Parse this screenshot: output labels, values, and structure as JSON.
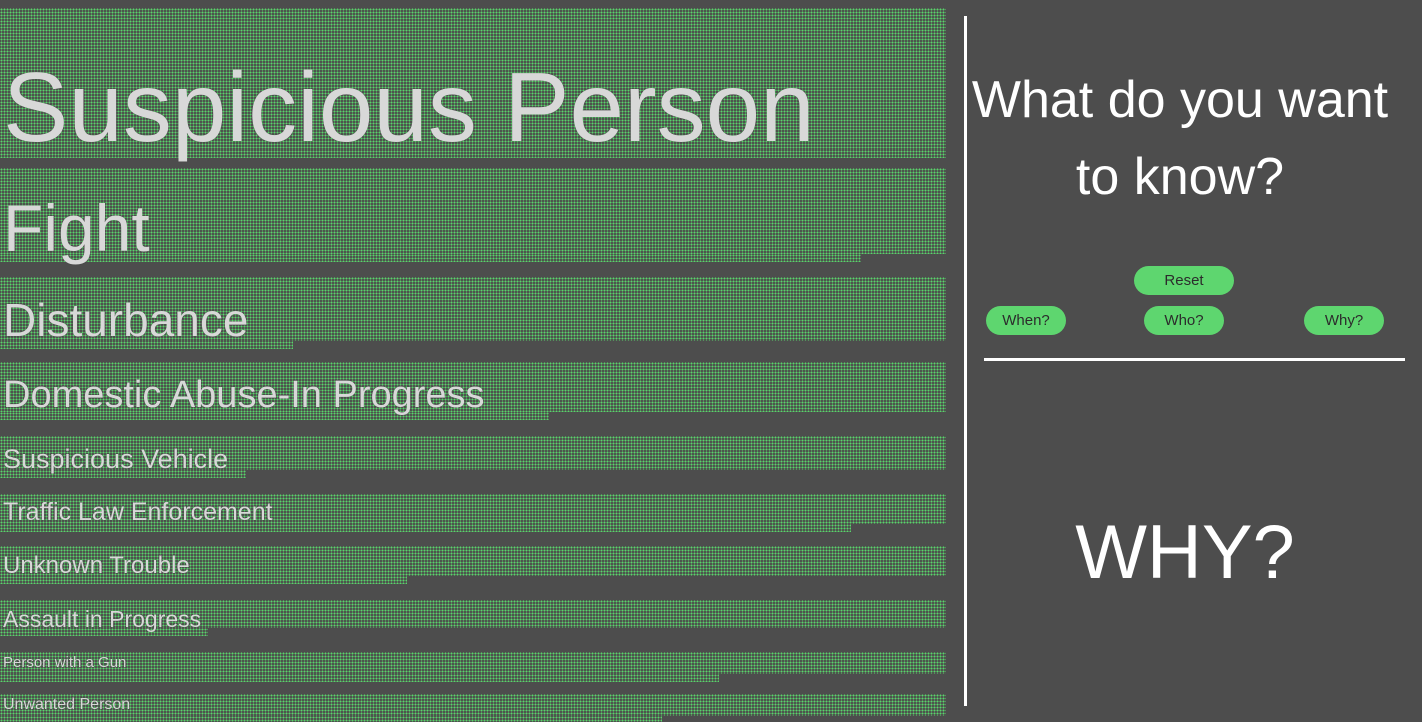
{
  "categories": [
    {
      "label": "Suspicious Person",
      "level": 1.0
    },
    {
      "label": "Fight",
      "level": 0.91
    },
    {
      "label": "Disturbance",
      "level": 0.31
    },
    {
      "label": "Domestic Abuse-In Progress",
      "level": 0.58
    },
    {
      "label": "Suspicious Vehicle",
      "level": 0.26
    },
    {
      "label": "Traffic Law Enforcement",
      "level": 0.9
    },
    {
      "label": "Unknown Trouble",
      "level": 0.43
    },
    {
      "label": "Assault in Progress",
      "level": 0.22
    },
    {
      "label": "Person with a Gun",
      "level": 0.76
    },
    {
      "label": "Unwanted Person",
      "level": 0.7
    }
  ],
  "sidebar": {
    "question": "What do you want to know?",
    "buttons": {
      "reset": "Reset",
      "when": "When?",
      "who": "Who?",
      "why": "Why?"
    },
    "answer": "WHY?"
  },
  "colors": {
    "background": "#4d4d4d",
    "dots": "#59d46a",
    "button": "#5ed66f",
    "text": "#ffffff"
  }
}
